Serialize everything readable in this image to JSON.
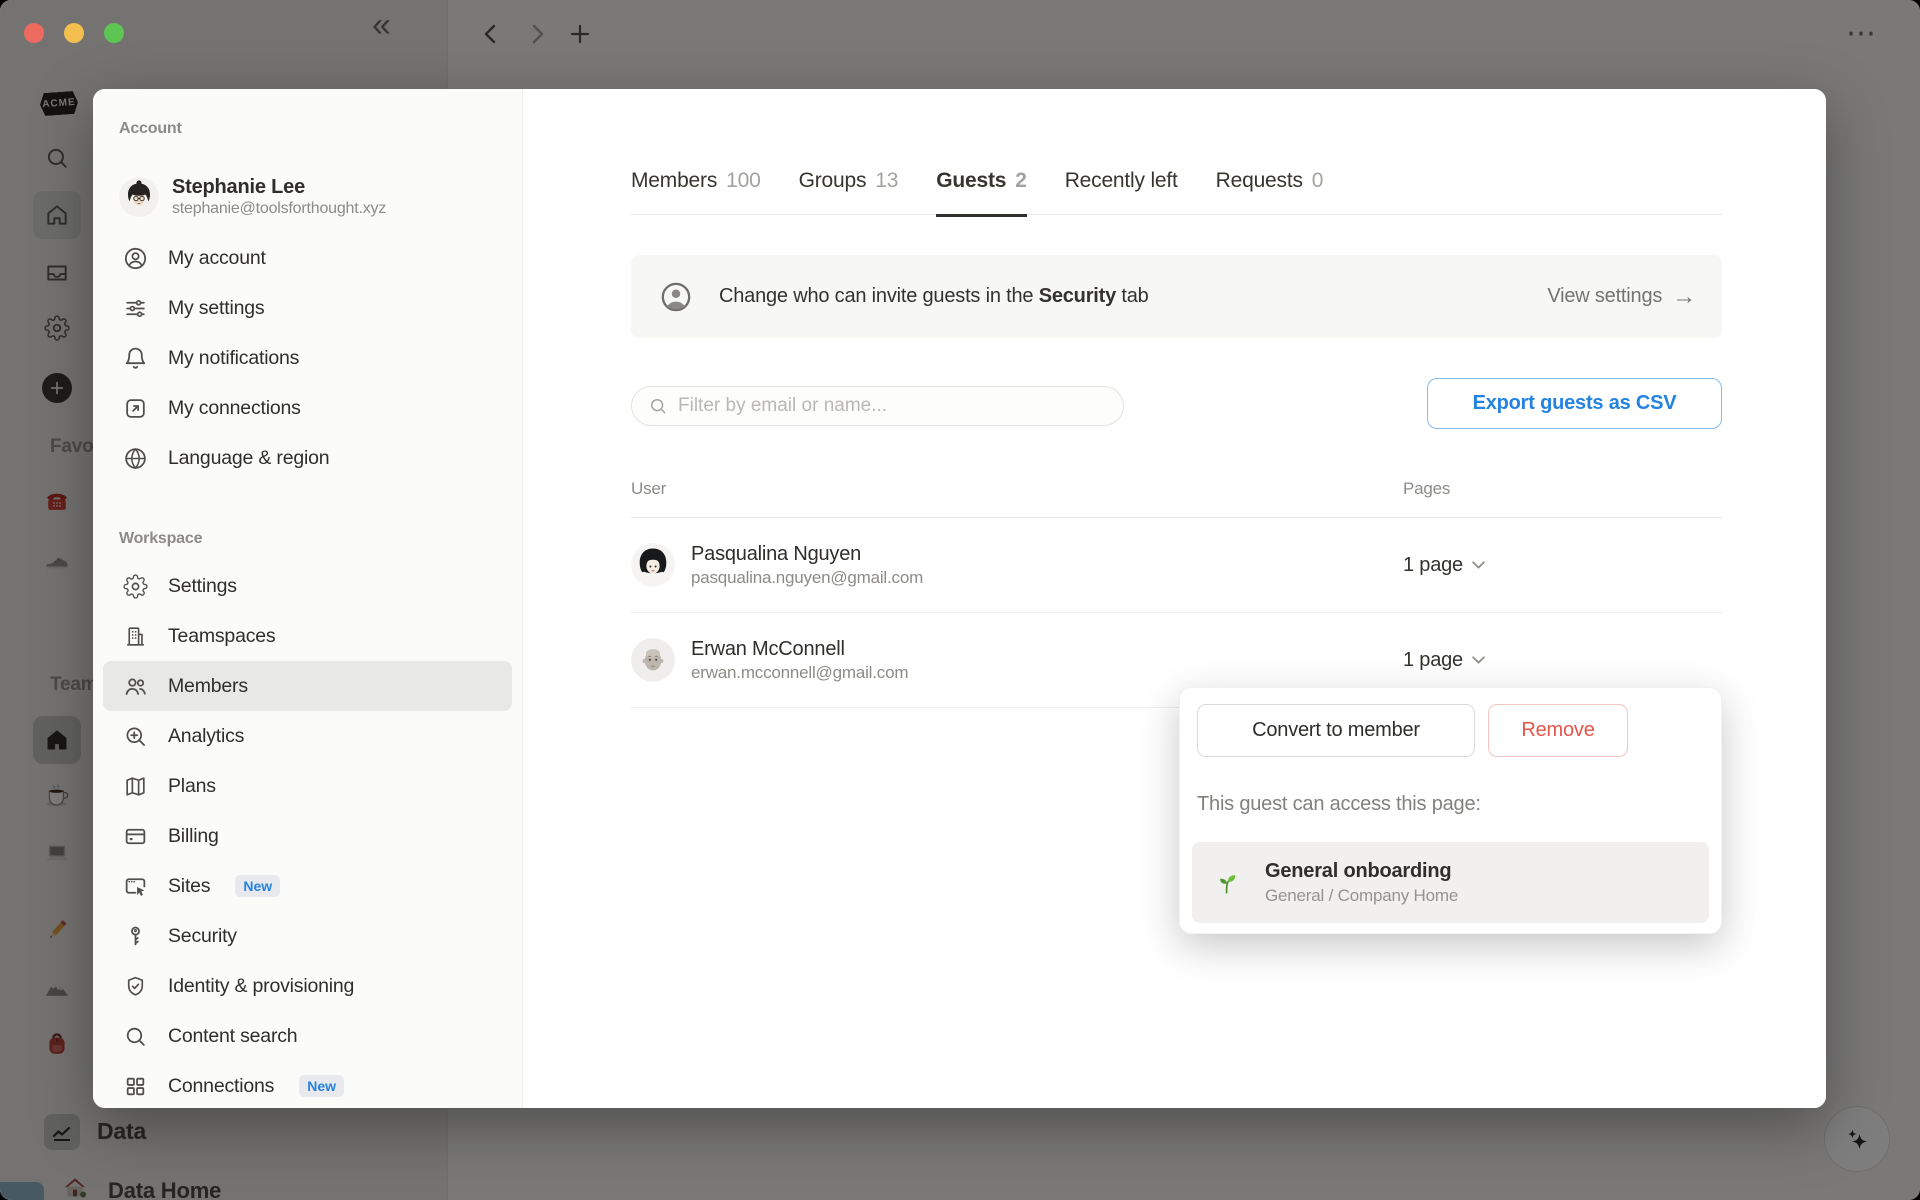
{
  "topbar": {
    "collapse_glyph": "«",
    "more_glyph": "⋯"
  },
  "background": {
    "workspace_badge": "ACME",
    "favorites_label": "Favorites",
    "teamspaces_label": "Teamspaces",
    "data_label": "Data",
    "data_home_label": "Data Home"
  },
  "modal": {
    "sidebar": {
      "account_header": "Account",
      "user": {
        "name": "Stephanie Lee",
        "email": "stephanie@toolsforthought.xyz"
      },
      "account_items": [
        {
          "label": "My account"
        },
        {
          "label": "My settings"
        },
        {
          "label": "My notifications"
        },
        {
          "label": "My connections"
        },
        {
          "label": "Language & region"
        }
      ],
      "workspace_header": "Workspace",
      "workspace_items": [
        {
          "label": "Settings"
        },
        {
          "label": "Teamspaces"
        },
        {
          "label": "Members"
        },
        {
          "label": "Analytics"
        },
        {
          "label": "Plans"
        },
        {
          "label": "Billing"
        },
        {
          "label": "Sites",
          "badge": "New"
        },
        {
          "label": "Security"
        },
        {
          "label": "Identity & provisioning"
        },
        {
          "label": "Content search"
        },
        {
          "label": "Connections",
          "badge": "New"
        }
      ]
    },
    "main": {
      "tabs": [
        {
          "label": "Members",
          "count": "100"
        },
        {
          "label": "Groups",
          "count": "13"
        },
        {
          "label": "Guests",
          "count": "2"
        },
        {
          "label": "Recently left",
          "count": ""
        },
        {
          "label": "Requests",
          "count": "0"
        }
      ],
      "banner": {
        "text_before": "Change who can invite guests in the ",
        "text_bold": "Security",
        "text_after": " tab",
        "action_label": "View settings",
        "action_arrow": "→"
      },
      "search_placeholder": "Filter by email or name...",
      "export_button": "Export guests as CSV",
      "table": {
        "col_user": "User",
        "col_pages": "Pages",
        "rows": [
          {
            "name": "Pasqualina Nguyen",
            "email": "pasqualina.nguyen@gmail.com",
            "pages": "1 page"
          },
          {
            "name": "Erwan McConnell",
            "email": "erwan.mcconnell@gmail.com",
            "pages": "1 page"
          }
        ]
      },
      "popover": {
        "convert_button": "Convert to member",
        "remove_button": "Remove",
        "caption": "This guest can access this page:",
        "page": {
          "title": "General onboarding",
          "path": "General / Company Home",
          "icon": "seedling"
        }
      }
    }
  },
  "colors": {
    "accent_blue": "#2383e2",
    "danger_red": "#eb5757"
  }
}
